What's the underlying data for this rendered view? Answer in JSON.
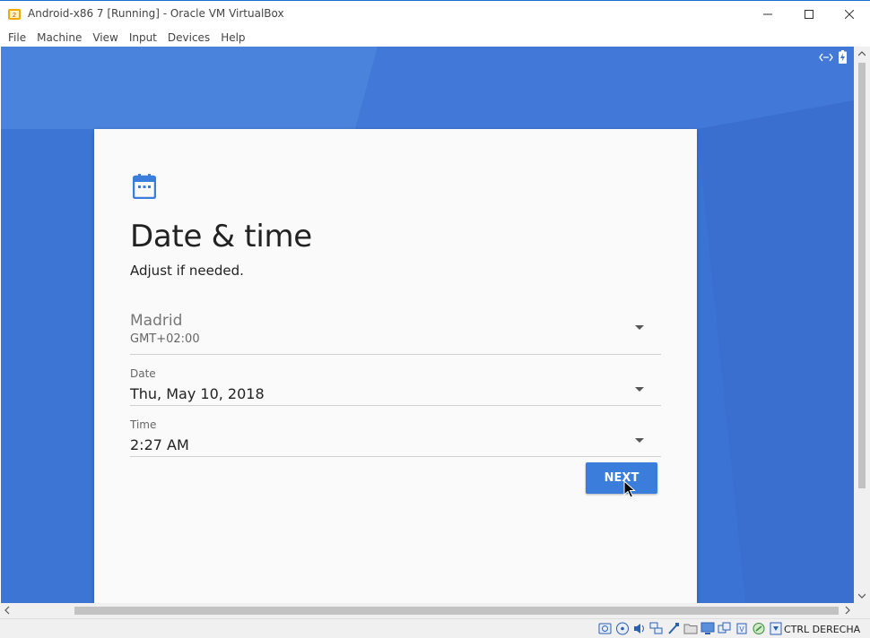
{
  "window": {
    "title": "Android-x86 7 [Running] - Oracle VM VirtualBox"
  },
  "menu": [
    "File",
    "Machine",
    "View",
    "Input",
    "Devices",
    "Help"
  ],
  "setup": {
    "heading": "Date & time",
    "subtitle": "Adjust if needed.",
    "timezone": {
      "value": "Madrid",
      "caption": "GMT+02:00"
    },
    "date": {
      "caption": "Date",
      "value": "Thu, May 10, 2018"
    },
    "time": {
      "caption": "Time",
      "value": "2:27 AM"
    },
    "next_label": "NEXT"
  },
  "statusbar": {
    "host_key": "CTRL DERECHA"
  },
  "colors": {
    "accent": "#3b7ddb",
    "vm_background": "#3f78d6",
    "card": "#fafafa"
  }
}
